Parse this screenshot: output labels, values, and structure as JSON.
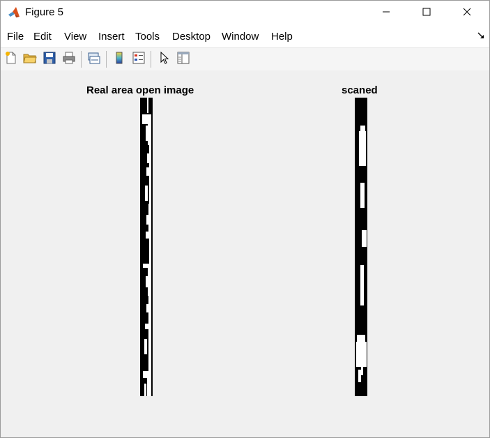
{
  "window": {
    "title": "Figure 5",
    "controls": [
      "minimize-icon",
      "maximize-icon",
      "close-icon"
    ]
  },
  "menubar": {
    "items": [
      "File",
      "Edit",
      "View",
      "Insert",
      "Tools",
      "Desktop",
      "Window",
      "Help"
    ],
    "dock_icon": "dock-arrow-icon"
  },
  "toolbar": {
    "buttons": [
      "new-figure-icon",
      "open-file-icon",
      "save-icon",
      "print-icon",
      "link-plot-icon",
      "insert-colorbar-icon",
      "insert-legend-icon",
      "edit-plot-pointer-icon",
      "property-inspector-icon"
    ]
  },
  "figure": {
    "axes": [
      {
        "title": "Real area open image"
      },
      {
        "title": "scaned"
      }
    ]
  },
  "colors": {
    "titlebar_bg": "#ffffff",
    "figure_bg": "#f0f0f0",
    "image_black": "#000000",
    "image_white": "#ffffff"
  }
}
